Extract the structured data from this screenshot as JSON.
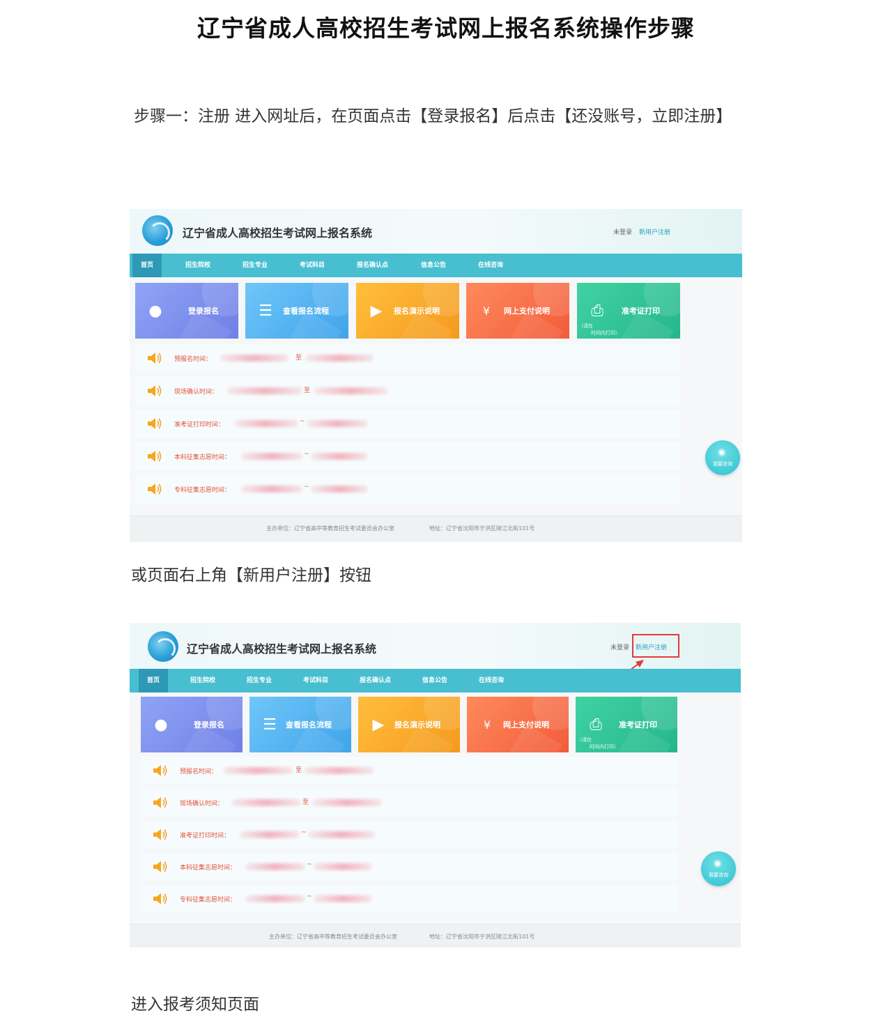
{
  "document": {
    "title": "辽宁省成人高校招生考试网上报名系统操作步骤",
    "step1_text": "步骤一：注册  进入网址后，在页面点击【登录报名】后点击【还没账号，立即注册】",
    "alt_text": "或页面右上角【新用户注册】按钮",
    "next_text": "进入报考须知页面"
  },
  "site": {
    "name": "辽宁省成人高校招生考试网上报名系统",
    "login_status": "未登录",
    "register_link": "新用户注册",
    "nav": [
      "首页",
      "招生院校",
      "招生专业",
      "考试科目",
      "报名确认点",
      "信息公告",
      "在线咨询"
    ],
    "tiles": [
      {
        "label": "登录报名",
        "icon": "user-icon",
        "color": "#7b8cec"
      },
      {
        "label": "查看报名流程",
        "icon": "document-icon",
        "color": "#4eb1f0"
      },
      {
        "label": "报名演示说明",
        "icon": "play-icon",
        "color": "#f9a825"
      },
      {
        "label": "网上支付说明",
        "icon": "payment-icon",
        "color": "#f4693f"
      },
      {
        "label": "准考证打印",
        "icon": "printer-icon",
        "color": "#2fc294"
      }
    ],
    "print_note_line1": "（请在",
    "print_note_line2": "时间内打印）",
    "rows": [
      {
        "label": "预报名时间：",
        "sep": "至"
      },
      {
        "label": "现场确认时间：",
        "sep": "至"
      },
      {
        "label": "准考证打印时间：",
        "sep": "~"
      },
      {
        "label": "本科征集志愿时间：",
        "sep": "~"
      },
      {
        "label": "专科征集志愿时间：",
        "sep": "~"
      }
    ],
    "consult_label": "我要咨询",
    "footer_org": "主办单位：辽宁省高中等教育招生考试委员会办公室",
    "footer_address": "地址：辽宁省沈阳市于洪区陵江北街101号",
    "accent_color": "#47bfd0",
    "highlight_color": "#e23a3a"
  }
}
